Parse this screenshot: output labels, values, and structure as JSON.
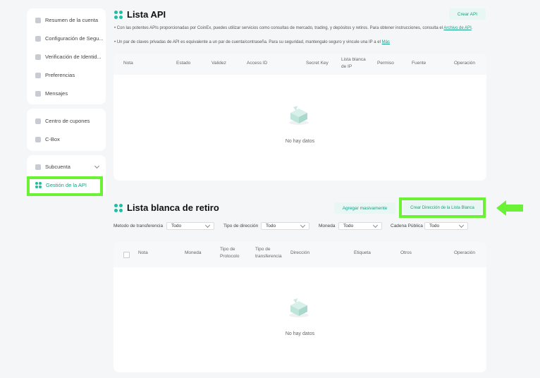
{
  "sidebar": {
    "group1": [
      "Resumen de la cuenta",
      "Configuración de Segu...",
      "Verificación de Identid...",
      "Preferencias",
      "Mensajes"
    ],
    "group2": [
      "Centro de cupones",
      "C-Box"
    ],
    "subaccount": "Subcuenta",
    "api_management": "Gestión de la API"
  },
  "api_list": {
    "title": "Lista API",
    "create_button": "Crear API",
    "info1_text": "Con las potentes APIs proporcionadas por CoinEx, puedes utilizar servicios como consultas de mercado, trading, y depósitos y retiros. Para obtener instrucciones, consulta el",
    "info1_link": "Archivo de API",
    "info2_text": "Un par de claves privadas de API es equivalente a un par de cuenta/contraseña. Para su seguridad, mantengalo seguro y vincule una IP a el",
    "info2_link": "Más",
    "columns": [
      "Nota",
      "Estado",
      "Validez",
      "Access ID",
      "Secret Key",
      "Lista blanca de IP",
      "Permiso",
      "Fuente",
      "Operación"
    ],
    "empty": "No hay datos"
  },
  "whitelist": {
    "title": "Lista blanca de retiro",
    "bulk_button": "Agregar masivamente",
    "create_button": "Crear Dirección de la Lista Blanca",
    "filters": [
      {
        "label": "Metodo de transferencia",
        "value": "Todo"
      },
      {
        "label": "Tipo de dirección",
        "value": "Todo"
      },
      {
        "label": "Moneda",
        "value": "Todo"
      },
      {
        "label": "Cadena Pública",
        "value": "Todo"
      }
    ],
    "columns": [
      "Nota",
      "Moneda",
      "Tipo de Protocolo",
      "Tipo de transferencia",
      "Dirección",
      "Etiqueta",
      "Otros",
      "Operación"
    ],
    "empty": "No hay datos"
  },
  "colors": {
    "accent": "#16a085",
    "highlight": "#6cf234"
  }
}
